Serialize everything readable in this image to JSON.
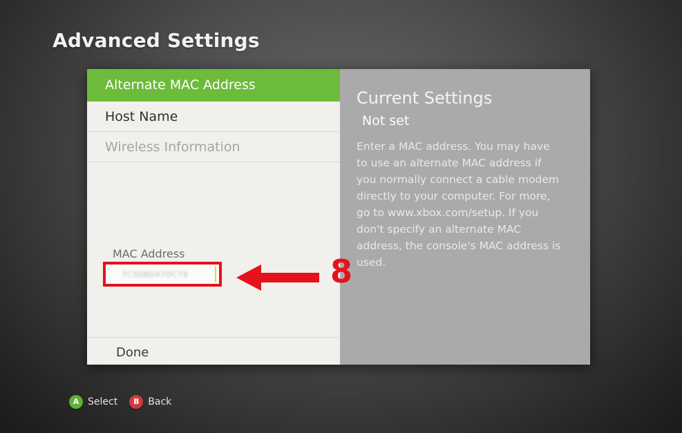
{
  "page": {
    "title": "Advanced Settings"
  },
  "menu": {
    "items": [
      {
        "label": "Alternate MAC Address",
        "state": "selected"
      },
      {
        "label": "Host Name",
        "state": "normal"
      },
      {
        "label": "Wireless Information",
        "state": "disabled"
      }
    ]
  },
  "mac_field": {
    "label": "MAC Address",
    "value": "7C3D8D47DC79"
  },
  "done": {
    "label": "Done"
  },
  "info": {
    "title": "Current Settings",
    "value": "Not set",
    "description": "Enter a MAC address. You may have to use an alternate MAC address if you normally connect a cable modem directly to your computer. For more, go to www.xbox.com/setup. If you don't specify an alternate MAC address, the console's MAC address is used."
  },
  "annotation": {
    "number": "8",
    "color": "#e4121b"
  },
  "footer": {
    "buttons": [
      {
        "key": "A",
        "label": "Select",
        "color": "#5cb232"
      },
      {
        "key": "B",
        "label": "Back",
        "color": "#d23a3a"
      }
    ]
  },
  "colors": {
    "accent_green": "#6dbb3a",
    "panel_light": "#f1f0ec",
    "panel_gray": "#a9aaa9"
  }
}
